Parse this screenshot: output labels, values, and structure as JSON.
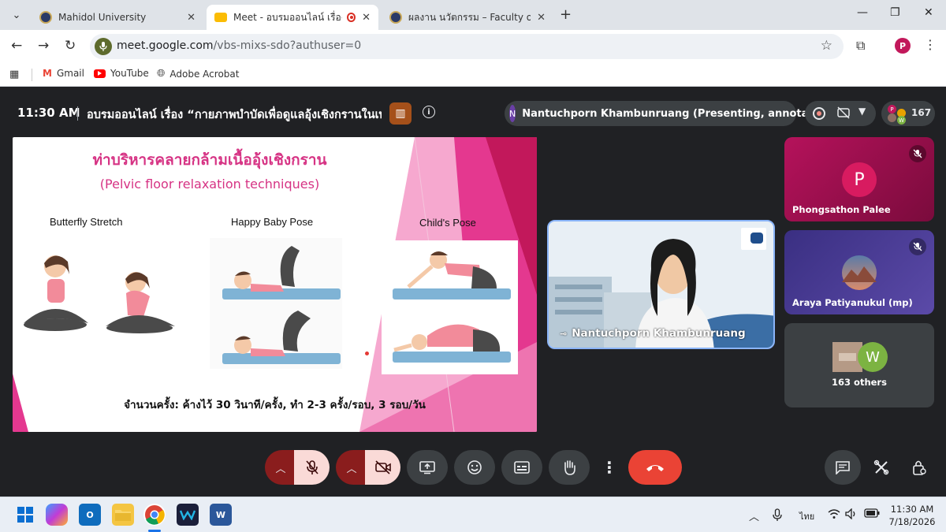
{
  "browser": {
    "tabs": [
      {
        "title": "Mahidol University",
        "active": false
      },
      {
        "title": "Meet - อบรมออนไลน์ เรื่อง “กา",
        "active": true
      },
      {
        "title": "ผลงาน นวัตกรรม – Faculty of Phy",
        "active": false
      }
    ],
    "url_domain": "meet.google.com",
    "url_path": "/vbs-mixs-sdo?authuser=0",
    "profile_initial": "P",
    "bookmarks": [
      "Gmail",
      "YouTube",
      "Adobe Acrobat"
    ]
  },
  "meeting": {
    "time": "11:30 AM",
    "title": "อบรมออนไลน์ เรื่อง “กายภาพบำบัดเพื่อดูแลอุ้งเชิงกรานในเพ...",
    "presenter_initial": "N",
    "presenter_status": "Nantuchporn Khambunruang (Presenting, annotating)",
    "participant_count": "167",
    "mini_avatars": [
      "P",
      "W"
    ]
  },
  "slide": {
    "title_th": "ท่าบริหารคลายกล้ามเนื้ออุ้งเชิงกราน",
    "title_en": "(Pelvic floor relaxation techniques)",
    "poses": [
      "Butterfly Stretch",
      "Happy Baby Pose",
      "Child's Pose"
    ],
    "footer": "จำนวนครั้ง: ค้างไว้ 30 วินาที/ครั้ง, ทำ 2-3 ครั้ง/รอบ, 3 รอบ/วัน"
  },
  "tiles": {
    "presenter_name": "Nantuchporn Khambunruang",
    "p1_initial": "P",
    "p1_name": "Phongsathon Palee",
    "p2_name": "Araya Patiyanukul (mp)",
    "others_initial": "W",
    "others_label": "163 others"
  },
  "taskbar": {
    "language": "ไทย",
    "time": "11:30 AM",
    "date": "7/18/2026"
  },
  "colors": {
    "accent_pink": "#d63384",
    "end_call": "#ea4335",
    "meet_bg": "#202124"
  }
}
